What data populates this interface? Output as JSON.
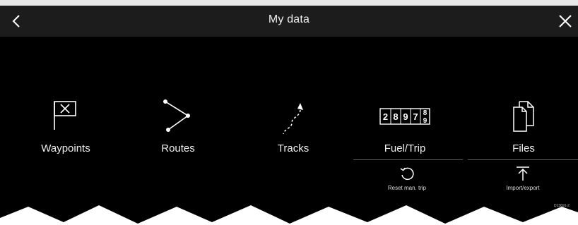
{
  "window": {
    "title": "My data",
    "back_icon": "chevron-left-icon",
    "close_icon": "close-icon"
  },
  "tiles": [
    {
      "label": "Waypoints",
      "icon": "waypoint-flag-icon"
    },
    {
      "label": "Routes",
      "icon": "route-icon"
    },
    {
      "label": "Tracks",
      "icon": "track-icon"
    },
    {
      "label": "Fuel/Trip",
      "icon": "trip-counter-icon",
      "counter_digits": [
        "2",
        "8",
        "9",
        "7"
      ],
      "counter_rolling": [
        "8",
        "9"
      ]
    },
    {
      "label": "Files",
      "icon": "files-icon"
    }
  ],
  "sub_actions": [
    {
      "label": "Reset man. trip",
      "icon": "reset-icon"
    },
    {
      "label": "Import/export",
      "icon": "import-export-icon"
    }
  ],
  "reference_code": "D13691-2",
  "colors": {
    "screen_background": "#000000",
    "titlebar_background": "#1c1c1c",
    "foreground": "#ffffff"
  }
}
